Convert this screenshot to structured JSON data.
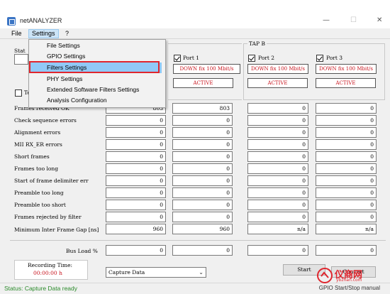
{
  "window": {
    "title": "netANALYZER",
    "minimize": "—",
    "maximize": "☐",
    "close": "✕"
  },
  "menubar": {
    "file": "File",
    "settings": "Settings",
    "help": "?"
  },
  "settings_menu": {
    "items": [
      {
        "label": "File Settings"
      },
      {
        "label": "GPIO Settings"
      },
      {
        "label": "Filters Settings"
      },
      {
        "label": "PHY Settings"
      },
      {
        "label": "Extended Software Filters Settings"
      },
      {
        "label": "Analysis Configuration"
      }
    ],
    "highlighted_index": 2
  },
  "left_panel": {
    "status_label_partial": "Stat",
    "checkbox_label_partial": "Te"
  },
  "tap_b": {
    "label": "TAP B"
  },
  "ports": [
    {
      "name": "Port 1",
      "link": "DOWN fix 100 Mbit/s",
      "state": "ACTIVE",
      "checked": true
    },
    {
      "name": "Port 2",
      "link": "DOWN fix 100 Mbit/s",
      "state": "ACTIVE",
      "checked": true
    },
    {
      "name": "Port 3",
      "link": "DOWN fix 100 Mbit/s",
      "state": "ACTIVE",
      "checked": true
    }
  ],
  "stats": {
    "rows": [
      {
        "label": "Frames received OK",
        "values": [
          "803",
          "803",
          "0",
          "0"
        ]
      },
      {
        "label": "Check sequence errors",
        "values": [
          "0",
          "0",
          "0",
          "0"
        ]
      },
      {
        "label": "Alignment errors",
        "values": [
          "0",
          "0",
          "0",
          "0"
        ]
      },
      {
        "label": "MII RX_ER errors",
        "values": [
          "0",
          "0",
          "0",
          "0"
        ]
      },
      {
        "label": "Short frames",
        "values": [
          "0",
          "0",
          "0",
          "0"
        ]
      },
      {
        "label": "Frames too long",
        "values": [
          "0",
          "0",
          "0",
          "0"
        ]
      },
      {
        "label": "Start of frame delimiter err",
        "values": [
          "0",
          "0",
          "0",
          "0"
        ]
      },
      {
        "label": "Preamble too long",
        "values": [
          "0",
          "0",
          "0",
          "0"
        ]
      },
      {
        "label": "Preamble too short",
        "values": [
          "0",
          "0",
          "0",
          "0"
        ]
      },
      {
        "label": "Frames rejected by filter",
        "values": [
          "0",
          "0",
          "0",
          "0"
        ]
      },
      {
        "label": "Minimum Inter Frame Gap [ns]",
        "values": [
          "960",
          "960",
          "n/a",
          "n/a"
        ]
      }
    ],
    "bus_load": {
      "label": "Bus Load %",
      "values": [
        "0",
        "0",
        "0",
        "0"
      ]
    }
  },
  "recording": {
    "label": "Recording Time:",
    "time": "00:00:00 h"
  },
  "capture_select": {
    "value": "Capture Data"
  },
  "buttons": {
    "start": "Start",
    "convert": "Convert"
  },
  "statusbar": {
    "text": "Status: Capture Data ready",
    "right": "GPIO Start/Stop manual"
  },
  "watermark": {
    "text": "仪商网",
    "sub": "ybzhan.com"
  },
  "colors": {
    "accent_red": "#c8141e",
    "status_green": "#2a8a2a",
    "highlight": "#91c9f7"
  }
}
